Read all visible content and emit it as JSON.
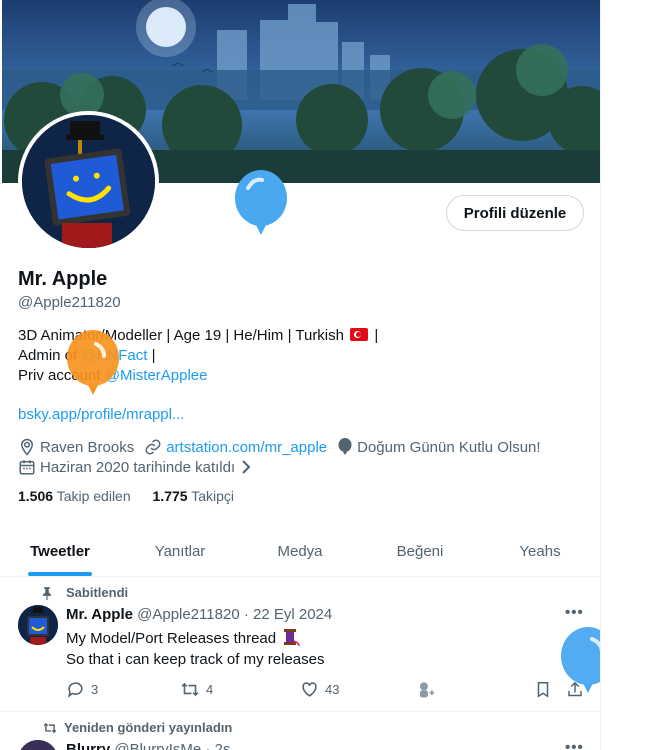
{
  "profile": {
    "name": "Mr. Apple",
    "handle": "@Apple211820",
    "edit_label": "Profili düzenle",
    "bio": {
      "line1": "3D Animator/Modeller |  Age 19  | He/Him  |  Turkish",
      "line1_tail": "|",
      "line2_prefix": "Admin of ",
      "line2_link": "@HNFact",
      "line2_tail": " |",
      "line3_prefix": "Priv account ",
      "line3_link": "@MisterApplee"
    },
    "website": "bsky.app/profile/mrappl...",
    "meta": {
      "location": "Raven Brooks",
      "link": "artstation.com/mr_apple",
      "birthday": "Doğum Günün Kutlu Olsun!",
      "joined": "Haziran 2020 tarihinde katıldı"
    },
    "following_count": "1.506",
    "following_label": "Takip edilen",
    "followers_count": "1.775",
    "followers_label": "Takipçi"
  },
  "tabs": [
    {
      "label": "Tweetler",
      "active": true
    },
    {
      "label": "Yanıtlar",
      "active": false
    },
    {
      "label": "Medya",
      "active": false
    },
    {
      "label": "Beğeni",
      "active": false
    },
    {
      "label": "Yeahs",
      "active": false
    }
  ],
  "pinned_tweet": {
    "pinned_label": "Sabitlendi",
    "author": "Mr. Apple",
    "handle": "@Apple211820",
    "separator": "·",
    "date": "22 Eyl 2024",
    "text_line1": "My Model/Port Releases thread",
    "text_line2": "So that i can keep track of my releases",
    "replies": "3",
    "retweets": "4",
    "likes": "43",
    "more": "•••"
  },
  "next_tweet": {
    "repost_label": "Yeniden gönderi yayınladın",
    "author": "Blurry",
    "handle": "@BlurryIsMe",
    "time": "· 2s",
    "more": "•••"
  },
  "colors": {
    "accent": "#1d9bf0",
    "balloon_blue": "#4aa8f0",
    "balloon_orange": "#f7931e",
    "flag_red": "#e30a17"
  },
  "icons": [
    "location-icon",
    "link-icon",
    "balloon-icon",
    "calendar-icon",
    "chevron-right-icon",
    "pin-icon",
    "reply-icon",
    "retweet-icon",
    "like-icon",
    "grok-icon",
    "bookmark-icon",
    "share-icon",
    "repost-icon",
    "more-icon"
  ]
}
